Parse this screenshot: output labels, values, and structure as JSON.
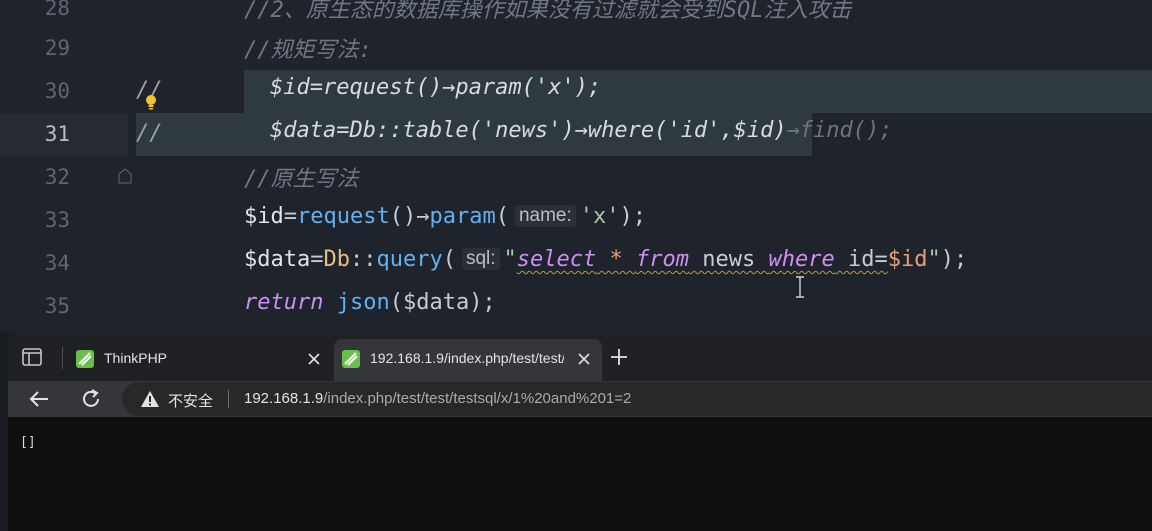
{
  "editor": {
    "lines": [
      {
        "num": "28",
        "text": "//2、原生态的数据库操作如果没有过滤就会受到SQL注入攻击"
      },
      {
        "num": "29",
        "text": "//规矩写法:"
      },
      {
        "num": "30",
        "gutter_comment": "//",
        "text": "$id=request()→param('x');"
      },
      {
        "num": "31",
        "gutter_comment": "//",
        "text": "$data=Db::table('news')→where('id',$id)",
        "ghost": "→find();"
      },
      {
        "num": "32",
        "text": "//原生写法"
      },
      {
        "num": "33",
        "parts": {
          "a": "$id",
          "b": "=",
          "c": "request",
          "d": "()→",
          "e": "param",
          "f": "(",
          "hint": "name:",
          "g": "'x'",
          "h": ");"
        }
      },
      {
        "num": "34",
        "parts": {
          "a": "$data",
          "b": "=",
          "c": "Db",
          "d": "::",
          "e": "query",
          "f": "(",
          "hint": "sql:",
          "q1": "\"",
          "s1": "select",
          "s2": " * ",
          "s3": "from",
          "s4": " news ",
          "s5": "where",
          "s6": " id=",
          "s7": "$id",
          "q2": "\"",
          "h": ");"
        }
      },
      {
        "num": "35",
        "parts": {
          "kw": "return",
          "fn": " json",
          "rest": "($data);"
        }
      }
    ]
  },
  "browser": {
    "tabs": [
      {
        "title": "ThinkPHP",
        "active": false
      },
      {
        "title": "192.168.1.9/index.php/test/test/t",
        "active": true
      }
    ],
    "address": {
      "security_label": "不安全",
      "host": "192.168.1.9",
      "path": "/index.php/test/test/testsql/x/1%20and%201=2"
    },
    "content_text": "[]"
  },
  "colors": {
    "editor_bg": "#1f232b",
    "selection": "#2f3a3f",
    "keyword": "#cf8ef2",
    "function": "#62b0f0",
    "string": "#a9c9a4",
    "class": "#e5c07b",
    "browser_tabbar": "#202124",
    "browser_toolbar": "#353639"
  },
  "icons": [
    "lightbulb-icon",
    "fold-marker-icon",
    "tab-actions-icon",
    "thinkphp-favicon",
    "close-icon",
    "plus-icon",
    "back-arrow-icon",
    "reload-icon",
    "warning-triangle-icon",
    "text-cursor-icon"
  ]
}
